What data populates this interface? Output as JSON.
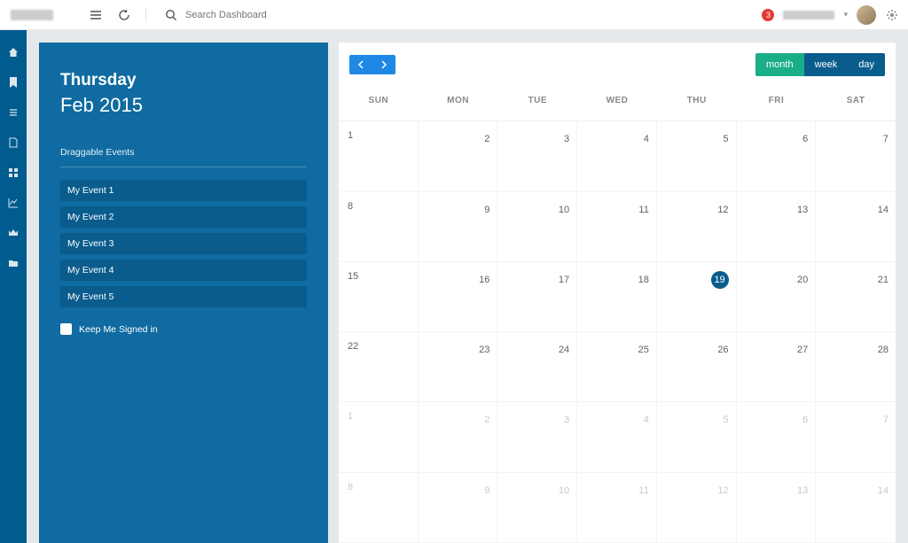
{
  "search": {
    "placeholder": "Search Dashboard"
  },
  "notifications": {
    "count": "3"
  },
  "events": {
    "day": "Thursday",
    "month": "Feb 2015",
    "section_title": "Draggable Events",
    "items": [
      "My Event 1",
      "My Event 2",
      "My Event 3",
      "My Event 4",
      "My Event 5"
    ],
    "keep_label": "Keep Me Signed in"
  },
  "calendar": {
    "views": {
      "month": "month",
      "week": "week",
      "day": "day"
    },
    "dow": [
      "SUN",
      "MON",
      "TUE",
      "WED",
      "THU",
      "FRI",
      "SAT"
    ],
    "cells": [
      {
        "n": "1",
        "other": false
      },
      {
        "n": "2",
        "other": false
      },
      {
        "n": "3",
        "other": false
      },
      {
        "n": "4",
        "other": false
      },
      {
        "n": "5",
        "other": false
      },
      {
        "n": "6",
        "other": false
      },
      {
        "n": "7",
        "other": false
      },
      {
        "n": "8",
        "other": false
      },
      {
        "n": "9",
        "other": false
      },
      {
        "n": "10",
        "other": false
      },
      {
        "n": "11",
        "other": false
      },
      {
        "n": "12",
        "other": false
      },
      {
        "n": "13",
        "other": false
      },
      {
        "n": "14",
        "other": false
      },
      {
        "n": "15",
        "other": false
      },
      {
        "n": "16",
        "other": false
      },
      {
        "n": "17",
        "other": false
      },
      {
        "n": "18",
        "other": false
      },
      {
        "n": "19",
        "other": false,
        "today": true
      },
      {
        "n": "20",
        "other": false
      },
      {
        "n": "21",
        "other": false
      },
      {
        "n": "22",
        "other": false
      },
      {
        "n": "23",
        "other": false
      },
      {
        "n": "24",
        "other": false
      },
      {
        "n": "25",
        "other": false
      },
      {
        "n": "26",
        "other": false
      },
      {
        "n": "27",
        "other": false
      },
      {
        "n": "28",
        "other": false
      },
      {
        "n": "1",
        "other": true
      },
      {
        "n": "2",
        "other": true
      },
      {
        "n": "3",
        "other": true
      },
      {
        "n": "4",
        "other": true
      },
      {
        "n": "5",
        "other": true
      },
      {
        "n": "6",
        "other": true
      },
      {
        "n": "7",
        "other": true
      },
      {
        "n": "8",
        "other": true
      },
      {
        "n": "9",
        "other": true
      },
      {
        "n": "10",
        "other": true
      },
      {
        "n": "11",
        "other": true
      },
      {
        "n": "12",
        "other": true
      },
      {
        "n": "13",
        "other": true
      },
      {
        "n": "14",
        "other": true
      }
    ]
  }
}
